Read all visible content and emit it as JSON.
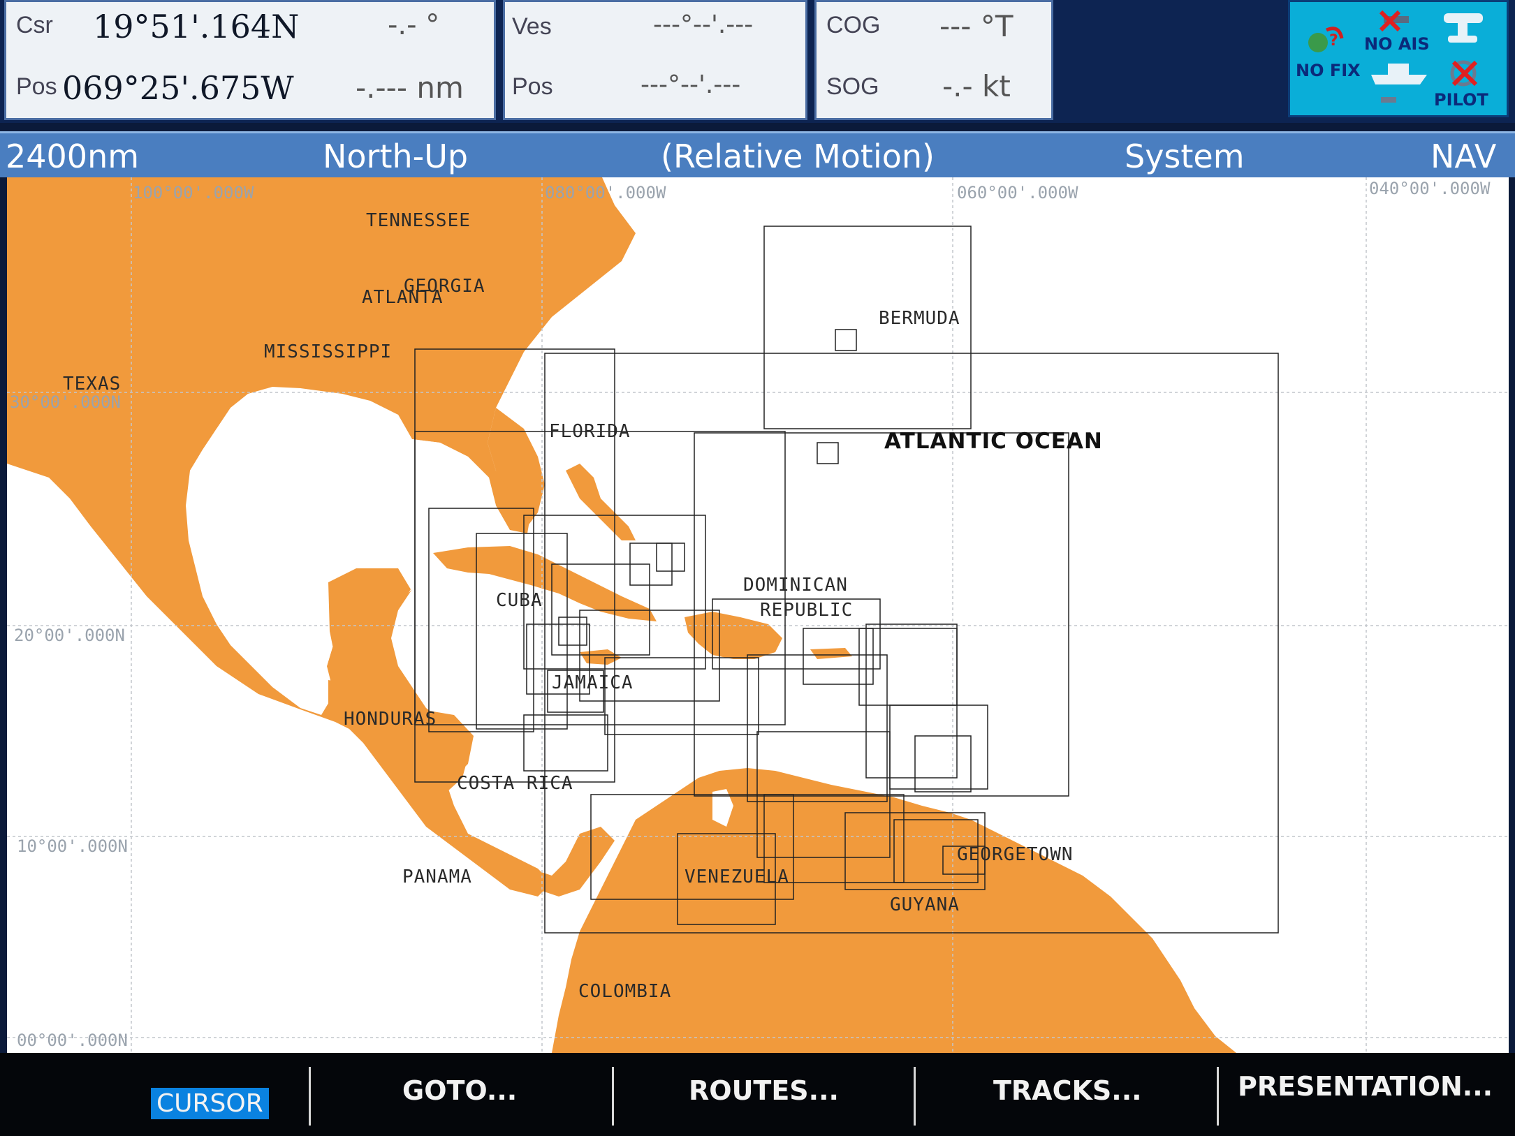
{
  "top_bar": {
    "cursor_panel": {
      "csr_label": "Csr",
      "csr_lat": "19°51'.164N",
      "csr_bearing": "-.- °",
      "pos_label": "Pos",
      "csr_lon": "069°25'.675W",
      "csr_range": "-.--- nm"
    },
    "vessel_panel": {
      "ves_label": "Ves",
      "ves_value": "---°--'.---",
      "pos_label": "Pos",
      "pos_value": "---°--'.---"
    },
    "course_panel": {
      "cog_label": "COG",
      "cog_value": "--- °T",
      "sog_label": "SOG",
      "sog_value": "-.- kt"
    },
    "status_panel": {
      "ais_text": "NO AIS",
      "fix_text": "NO FIX",
      "pilot_text": "PILOT"
    }
  },
  "header": {
    "range": "2400nm",
    "orientation": "North-Up",
    "motion": "(Relative Motion)",
    "system": "System",
    "mode": "NAV"
  },
  "chart": {
    "grid_labels": {
      "lon_100": "100°00'.000W",
      "lon_080": "080°00'.000W",
      "lon_060": "060°00'.000W",
      "lon_040": "040°00'.000W",
      "lat_30": "30°00'.000N",
      "lat_20": "20°00'.000N",
      "lat_10": "10°00'.000N",
      "lat_00": "00°00'.000N"
    },
    "places": {
      "tennessee": "TENNESSEE",
      "georgia": "GEORGIA",
      "atlanta": "ATLANTA",
      "mississippi": "MISSISSIPPI",
      "texas": "TEXAS",
      "bermuda": "BERMUDA",
      "florida": "FLORIDA",
      "atlantic": "ATLANTIC OCEAN",
      "dominican": "DOMINICAN",
      "republic": "REPUBLIC",
      "cuba": "CUBA",
      "jamaica": "JAMAICA",
      "honduras": "HONDURAS",
      "costa_rica": "COSTA RICA",
      "panama": "PANAMA",
      "venezuela": "VENEZUELA",
      "georgetown": "GEORGETOWN",
      "guyana": "GUYANA",
      "colombia": "COLOMBIA"
    }
  },
  "softkeys": {
    "cursor": "CURSOR",
    "goto": "GOTO...",
    "routes": "ROUTES...",
    "tracks": "TRACKS...",
    "presentation": "PRESENTATION..."
  },
  "colors": {
    "land": "#f19a3c",
    "land_light": "#f7b870",
    "sea": "#ffffff",
    "header": "#4a7ec0",
    "status": "#0aaed8"
  }
}
